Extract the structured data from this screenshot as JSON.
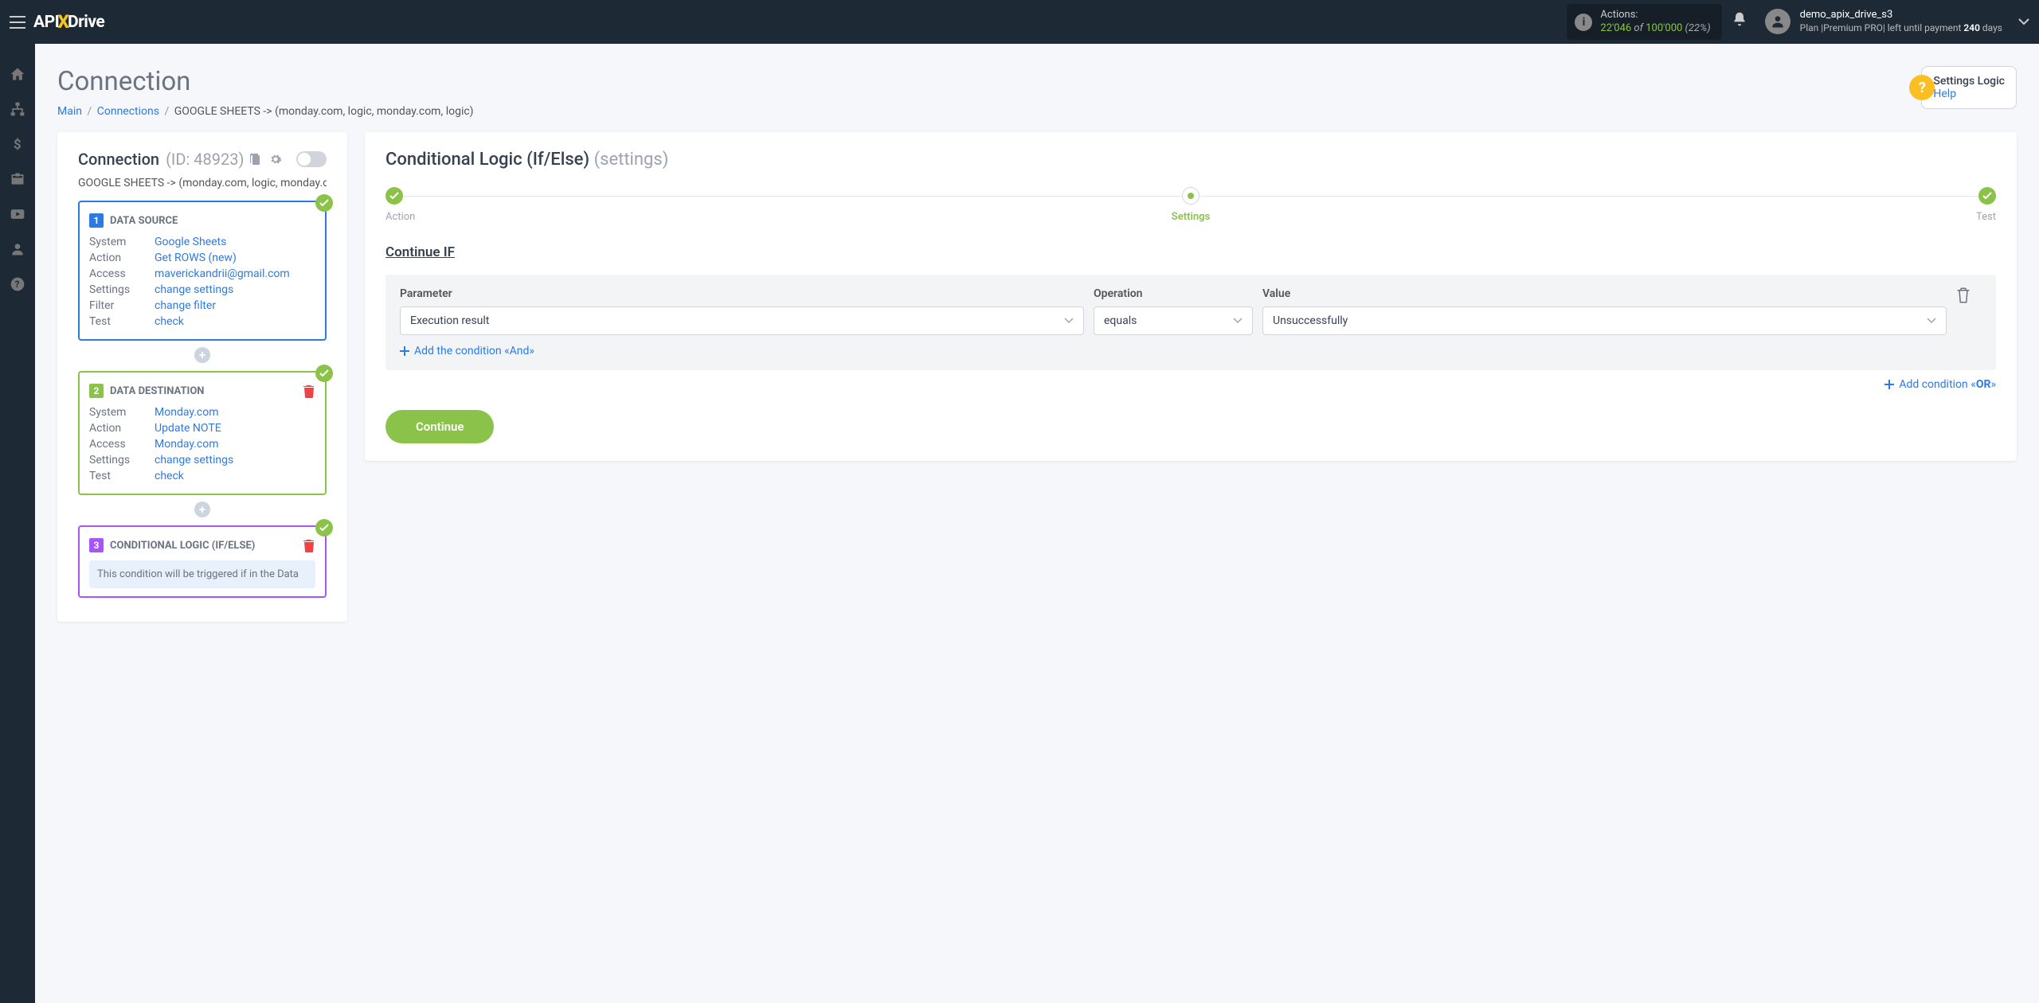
{
  "topbar": {
    "actions_label": "Actions:",
    "actions_used": "22'046",
    "actions_of": " of ",
    "actions_total": "100'000",
    "actions_pct": " (22%)",
    "username": "demo_apix_drive_s3",
    "plan_prefix": "Plan |Premium PRO| left until payment ",
    "plan_days": "240",
    "plan_suffix": " days"
  },
  "page": {
    "title": "Connection",
    "bc_main": "Main",
    "bc_connections": "Connections",
    "bc_current": "GOOGLE SHEETS -> (monday.com, logic, monday.com, logic)"
  },
  "help": {
    "title": "Settings Logic",
    "link": "Help"
  },
  "connection": {
    "title": "Connection",
    "id": "(ID: 48923)",
    "subtitle": "GOOGLE SHEETS -> (monday.com, logic, monday.com, logic)"
  },
  "source": {
    "num": "1",
    "title": "DATA SOURCE",
    "rows": {
      "system_l": "System",
      "system_v": "Google Sheets",
      "action_l": "Action",
      "action_v": "Get ROWS (new)",
      "access_l": "Access",
      "access_v": "maverickandrii@gmail.com",
      "settings_l": "Settings",
      "settings_v": "change settings",
      "filter_l": "Filter",
      "filter_v": "change filter",
      "test_l": "Test",
      "test_v": "check"
    }
  },
  "destination": {
    "num": "2",
    "title": "DATA DESTINATION",
    "rows": {
      "system_l": "System",
      "system_v": "Monday.com",
      "action_l": "Action",
      "action_v": "Update NOTE",
      "access_l": "Access",
      "access_v": "Monday.com",
      "settings_l": "Settings",
      "settings_v": "change settings",
      "test_l": "Test",
      "test_v": "check"
    }
  },
  "logic": {
    "num": "3",
    "title": "CONDITIONAL LOGIC (IF/ELSE)",
    "desc": "This condition will be triggered if in the Data"
  },
  "main": {
    "title": "Conditional Logic (If/Else)",
    "subtitle": "(settings)",
    "wiz_action": "Action",
    "wiz_settings": "Settings",
    "wiz_test": "Test",
    "section": "Continue IF",
    "param_l": "Parameter",
    "operation_l": "Operation",
    "value_l": "Value",
    "param_v": "Execution result",
    "operation_v": "equals",
    "value_v": "Unsuccessfully",
    "add_and": "Add the condition «And»",
    "add_or_pre": "Add condition «",
    "add_or_or": "OR",
    "add_or_post": "»",
    "continue": "Continue"
  }
}
